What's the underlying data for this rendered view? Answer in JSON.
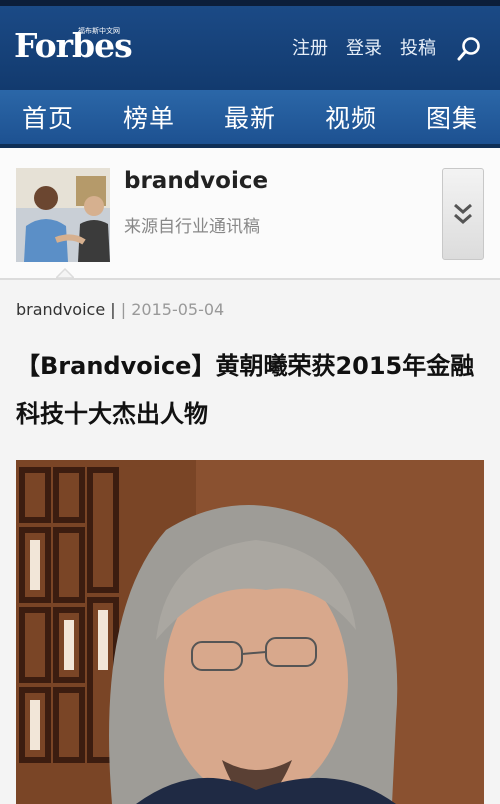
{
  "header": {
    "logo": "Forbes",
    "logo_sub": "福布斯中文网",
    "links": [
      "注册",
      "登录",
      "投稿"
    ]
  },
  "nav": {
    "items": [
      "首页",
      "榜单",
      "最新",
      "视频",
      "图集"
    ]
  },
  "author": {
    "name": "brandvoice",
    "description": "来源自行业通讯稿"
  },
  "article": {
    "byline": "brandvoice |",
    "separator": "|",
    "date": "2015-05-04",
    "title": "【Brandvoice】黄朝曦荣获2015年金融科技十大杰出人物"
  },
  "colors": {
    "header_bg": "#1b4a86",
    "nav_bg": "#2b67a8"
  }
}
